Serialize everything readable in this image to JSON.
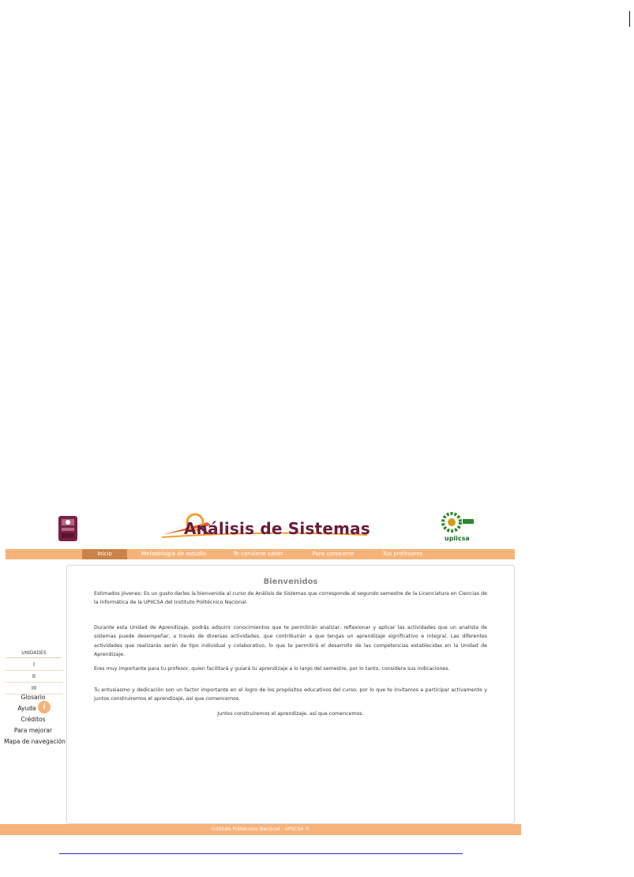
{
  "header": {
    "title": "Análisis de Sistemas",
    "logo_left": "ipn-logo",
    "logo_right_caption": "upiicsa"
  },
  "nav": {
    "items": [
      {
        "label": "Inicio",
        "active": true
      },
      {
        "label": "Metodología de estudio",
        "active": false
      },
      {
        "label": "Te conviene saber",
        "active": false
      },
      {
        "label": "Para conocerte",
        "active": false
      },
      {
        "label": "Tus profesores",
        "active": false
      }
    ]
  },
  "sidebar": {
    "units_label": "UNIDADES",
    "units": [
      "I",
      "II",
      "III"
    ],
    "links": [
      "Glosario",
      "Ayuda",
      "Créditos",
      "Para mejorar",
      "Mapa de navegación"
    ],
    "help_badge": "i"
  },
  "content": {
    "title": "Bienvenidos",
    "paragraphs": [
      "Estimados jóvenes: Es un gusto darles la bienvenida al curso de Análisis de Sistemas que corresponde al segundo semestre de la Licenciatura en Ciencias de la Informática de la UPIICSA del Instituto Politécnico Nacional.",
      "Durante esta Unidad de Aprendizaje, podrás adquirir conocimientos que te permitirán analizar, reflexionar y aplicar las actividades que un analista de sistemas puede desempeñar, a través de diversas actividades, que contribuirán a que tengas un aprendizaje significativo e integral. Las diferentes actividades que realizarás serán de tipo individual y colaborativo, lo que te permitirá el desarrollo de las competencias establecidas en la Unidad de Aprendizaje.",
      "Eres muy importante para tu profesor, quien facilitará y guiará tu aprendizaje a lo largo del semestre, por lo tanto, considera sus indicaciones.",
      "Tu entusiasmo y dedicación son un factor importante en el logro de los propósitos educativos del curso, por lo que te invitamos a participar activamente y juntos construiremos el aprendizaje, así que comencemos.",
      "Juntos construiremos el aprendizaje, así que comencemos."
    ]
  },
  "footer": {
    "text": "Instituto Politécnico Nacional - UPIICSA ©"
  },
  "colors": {
    "accent": "#f5b37a",
    "active_tab": "#c9834a",
    "title_maroon": "#6a1a3a",
    "link_blue": "#2b2bbf"
  }
}
